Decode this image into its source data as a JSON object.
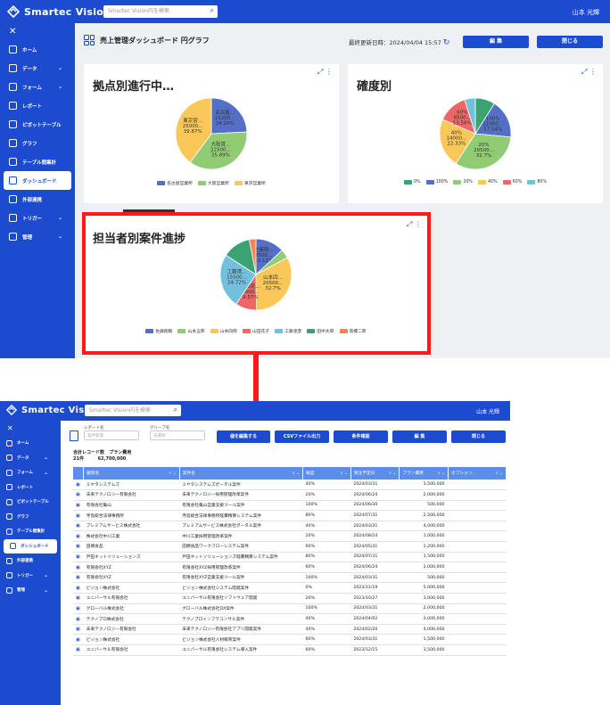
{
  "app": {
    "name": "Smartec Vision",
    "search_placeholder": "Smartec Vision内を検索",
    "user": "山本 光輝"
  },
  "sidebar": {
    "close": "✕",
    "items": [
      {
        "label": "ホーム",
        "icon": "home-icon"
      },
      {
        "label": "データ",
        "icon": "database-icon",
        "chevron": "⌄"
      },
      {
        "label": "フォーム",
        "icon": "form-icon",
        "chevron": "⌄"
      },
      {
        "label": "レポート",
        "icon": "report-icon"
      },
      {
        "label": "ピボットテーブル",
        "icon": "pivot-icon"
      },
      {
        "label": "グラフ",
        "icon": "chart-icon"
      },
      {
        "label": "テーブル間集計",
        "icon": "table-agg-icon"
      },
      {
        "label": "ダッシュボード",
        "icon": "dashboard-icon"
      },
      {
        "label": "外部連携",
        "icon": "external-icon"
      },
      {
        "label": "トリガー",
        "icon": "trigger-icon",
        "chevron": "⌄"
      },
      {
        "label": "管理",
        "icon": "gear-icon",
        "chevron": "⌄"
      }
    ]
  },
  "dashboard": {
    "title": "売上管理ダッシュボード 円グラフ",
    "updated": "最終更新日時：2024/04/04 15:57",
    "refresh_icon": "refresh-icon",
    "edit": "編 集",
    "close": "閉じる",
    "cards": [
      {
        "title": "拠点別進行中…",
        "slices": [
          {
            "label": "名古屋営業所",
            "value": 24.24,
            "text": "名古屋...\n15200...\n24.24%",
            "color": "#5470c6"
          },
          {
            "label": "大阪営業所",
            "value": 35.89,
            "text": "大阪営...\n22500...\n35.89%",
            "color": "#91cc75"
          },
          {
            "label": "東京営業所",
            "value": 39.87,
            "text": "東京営...\n25000...\n39.87%",
            "color": "#fac858"
          }
        ]
      },
      {
        "title": "確度別",
        "slices": [
          {
            "label": "0%",
            "value": 9.0,
            "text": "",
            "color": "#3ba272"
          },
          {
            "label": "100%",
            "value": 17.54,
            "text": "100%\n11000...\n17.54%",
            "color": "#5470c6"
          },
          {
            "label": "20%",
            "value": 32.7,
            "text": "20%\n20500...\n32.7%",
            "color": "#91cc75"
          },
          {
            "label": "40%",
            "value": 22.33,
            "text": "40%\n14000...\n22.33%",
            "color": "#fac858"
          },
          {
            "label": "60%",
            "value": 13.56,
            "text": "60%\n8500...\n13.56%",
            "color": "#ee6666"
          },
          {
            "label": "80%",
            "value": 4.87,
            "text": "",
            "color": "#73c0de"
          }
        ]
      },
      {
        "title": "担当者別案件進捗",
        "slices": [
          {
            "label": "佐藤翔哉",
            "value": 13.11,
            "text": "佐藤翔...\n8500...\n13.11%",
            "color": "#5470c6"
          },
          {
            "label": "山本五郎",
            "value": 4.0,
            "text": "",
            "color": "#91cc75"
          },
          {
            "label": "山本四郎",
            "value": 32.7,
            "text": "山本四...\n20500...\n32.7%",
            "color": "#fac858"
          },
          {
            "label": "山田花子",
            "value": 9.57,
            "text": "山田花...\n6000...\n9.57%",
            "color": "#ee6666"
          },
          {
            "label": "工藤達彦",
            "value": 24.72,
            "text": "工藤達...\n15500...\n24.72%",
            "color": "#73c0de"
          },
          {
            "label": "田中太郎",
            "value": 12.9,
            "text": "",
            "color": "#3ba272"
          },
          {
            "label": "高橋二郎",
            "value": 3.0,
            "text": "",
            "color": "#fc8452"
          }
        ]
      }
    ]
  },
  "report": {
    "report_name_label": "レポート名",
    "report_name_value": "案件管理",
    "group_label": "グループ名",
    "group_value": "未選択",
    "buttons": [
      "値を編集する",
      "CSVファイル出力",
      "条件確認",
      "編 集",
      "閉じる"
    ],
    "total_label": "合計レコード数",
    "total_value": "21件",
    "plan_label": "プラン費用",
    "plan_value": "62,700,000",
    "columns": [
      "顧客名",
      "案件名",
      "確度",
      "受注予定日",
      "プラン費用",
      "オプション..."
    ],
    "rows": [
      [
        "ミヤタシステムズ",
        "ミヤタシステムズポータル案件",
        "40%",
        "2024/03/31",
        "3,500,000"
      ],
      [
        "未来テクノロジー有限会社",
        "未来テクノロジー採用管理改革案件",
        "20%",
        "2024/06/24",
        "2,000,000"
      ],
      [
        "有限会社亀山",
        "有限会社亀山営業支援ツール案件",
        "100%",
        "2024/06/30",
        "500,000"
      ],
      [
        "寺島総合法律事務所",
        "寺島総合法律事務所経費精算システム案件",
        "80%",
        "2024/07/31",
        "2,500,000"
      ],
      [
        "プレミアムサービス株式会社",
        "プレミアムサービス株式会社ポータル案件",
        "40%",
        "2024/03/31",
        "4,000,000"
      ],
      [
        "株式会社中川工業",
        "中川工業採用管理改革案件",
        "20%",
        "2024/08/24",
        "1,000,000"
      ],
      [
        "田端食品",
        "田端食品ワークフローシステム案件",
        "60%",
        "2024/05/31",
        "1,200,000"
      ],
      [
        "戸田ネットソリューションズ",
        "戸田ネットソリューションズ経費精算システム案件",
        "80%",
        "2024/07/31",
        "1,500,000"
      ],
      [
        "有限会社XYZ",
        "有限会社XYZ採用管理改革案件",
        "60%",
        "2024/06/24",
        "2,000,000"
      ],
      [
        "有限会社XYZ",
        "有限会社XYZ営業支援ツール案件",
        "100%",
        "2024/03/31",
        "500,000"
      ],
      [
        "ビジョン株式会社",
        "ビジョン株式会社システム開発案件",
        "0%",
        "2023/12/19",
        "5,000,000"
      ],
      [
        "ユニバーサル有限会社",
        "ユニバーサル有限会社ソフトウェア開発",
        "20%",
        "2023/10/27",
        "1,000,000"
      ],
      [
        "グローバル株式会社",
        "グローバル株式会社DX案件",
        "100%",
        "2024/03/31",
        "2,000,000"
      ],
      [
        "テクノプロ株式会社",
        "テクノプロインフラコンサル案件",
        "40%",
        "2024/04/02",
        "2,000,000"
      ],
      [
        "未来テクノロジー有限会社",
        "未来テクノロジー有限会社アプリ開発案件",
        "40%",
        "2024/02/20",
        "4,000,000"
      ],
      [
        "ビジョン株式会社",
        "ビジョン株式会社人材教育案件",
        "60%",
        "2024/03/31",
        "1,500,000"
      ],
      [
        "ユニバーサル有限会社",
        "ユニバーサル有限会社システム導入案件",
        "60%",
        "2023/12/15",
        "3,500,000"
      ]
    ]
  }
}
